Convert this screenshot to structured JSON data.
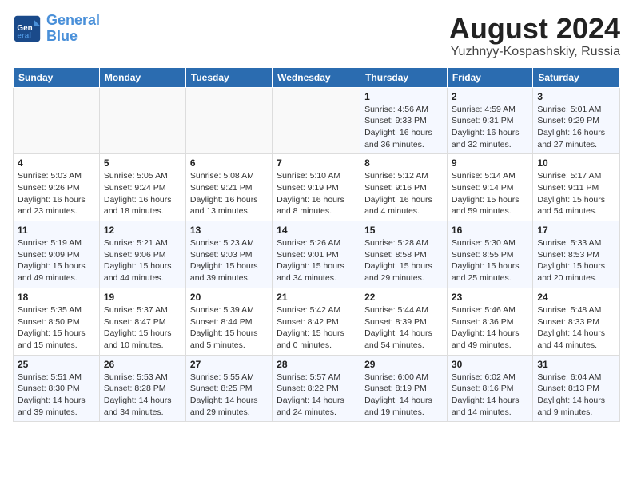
{
  "logo": {
    "line1": "General",
    "line2": "Blue"
  },
  "title": "August 2024",
  "subtitle": "Yuzhnyy-Kospashskiy, Russia",
  "days_of_week": [
    "Sunday",
    "Monday",
    "Tuesday",
    "Wednesday",
    "Thursday",
    "Friday",
    "Saturday"
  ],
  "weeks": [
    [
      {
        "day": "",
        "info": ""
      },
      {
        "day": "",
        "info": ""
      },
      {
        "day": "",
        "info": ""
      },
      {
        "day": "",
        "info": ""
      },
      {
        "day": "1",
        "info": "Sunrise: 4:56 AM\nSunset: 9:33 PM\nDaylight: 16 hours\nand 36 minutes."
      },
      {
        "day": "2",
        "info": "Sunrise: 4:59 AM\nSunset: 9:31 PM\nDaylight: 16 hours\nand 32 minutes."
      },
      {
        "day": "3",
        "info": "Sunrise: 5:01 AM\nSunset: 9:29 PM\nDaylight: 16 hours\nand 27 minutes."
      }
    ],
    [
      {
        "day": "4",
        "info": "Sunrise: 5:03 AM\nSunset: 9:26 PM\nDaylight: 16 hours\nand 23 minutes."
      },
      {
        "day": "5",
        "info": "Sunrise: 5:05 AM\nSunset: 9:24 PM\nDaylight: 16 hours\nand 18 minutes."
      },
      {
        "day": "6",
        "info": "Sunrise: 5:08 AM\nSunset: 9:21 PM\nDaylight: 16 hours\nand 13 minutes."
      },
      {
        "day": "7",
        "info": "Sunrise: 5:10 AM\nSunset: 9:19 PM\nDaylight: 16 hours\nand 8 minutes."
      },
      {
        "day": "8",
        "info": "Sunrise: 5:12 AM\nSunset: 9:16 PM\nDaylight: 16 hours\nand 4 minutes."
      },
      {
        "day": "9",
        "info": "Sunrise: 5:14 AM\nSunset: 9:14 PM\nDaylight: 15 hours\nand 59 minutes."
      },
      {
        "day": "10",
        "info": "Sunrise: 5:17 AM\nSunset: 9:11 PM\nDaylight: 15 hours\nand 54 minutes."
      }
    ],
    [
      {
        "day": "11",
        "info": "Sunrise: 5:19 AM\nSunset: 9:09 PM\nDaylight: 15 hours\nand 49 minutes."
      },
      {
        "day": "12",
        "info": "Sunrise: 5:21 AM\nSunset: 9:06 PM\nDaylight: 15 hours\nand 44 minutes."
      },
      {
        "day": "13",
        "info": "Sunrise: 5:23 AM\nSunset: 9:03 PM\nDaylight: 15 hours\nand 39 minutes."
      },
      {
        "day": "14",
        "info": "Sunrise: 5:26 AM\nSunset: 9:01 PM\nDaylight: 15 hours\nand 34 minutes."
      },
      {
        "day": "15",
        "info": "Sunrise: 5:28 AM\nSunset: 8:58 PM\nDaylight: 15 hours\nand 29 minutes."
      },
      {
        "day": "16",
        "info": "Sunrise: 5:30 AM\nSunset: 8:55 PM\nDaylight: 15 hours\nand 25 minutes."
      },
      {
        "day": "17",
        "info": "Sunrise: 5:33 AM\nSunset: 8:53 PM\nDaylight: 15 hours\nand 20 minutes."
      }
    ],
    [
      {
        "day": "18",
        "info": "Sunrise: 5:35 AM\nSunset: 8:50 PM\nDaylight: 15 hours\nand 15 minutes."
      },
      {
        "day": "19",
        "info": "Sunrise: 5:37 AM\nSunset: 8:47 PM\nDaylight: 15 hours\nand 10 minutes."
      },
      {
        "day": "20",
        "info": "Sunrise: 5:39 AM\nSunset: 8:44 PM\nDaylight: 15 hours\nand 5 minutes."
      },
      {
        "day": "21",
        "info": "Sunrise: 5:42 AM\nSunset: 8:42 PM\nDaylight: 15 hours\nand 0 minutes."
      },
      {
        "day": "22",
        "info": "Sunrise: 5:44 AM\nSunset: 8:39 PM\nDaylight: 14 hours\nand 54 minutes."
      },
      {
        "day": "23",
        "info": "Sunrise: 5:46 AM\nSunset: 8:36 PM\nDaylight: 14 hours\nand 49 minutes."
      },
      {
        "day": "24",
        "info": "Sunrise: 5:48 AM\nSunset: 8:33 PM\nDaylight: 14 hours\nand 44 minutes."
      }
    ],
    [
      {
        "day": "25",
        "info": "Sunrise: 5:51 AM\nSunset: 8:30 PM\nDaylight: 14 hours\nand 39 minutes."
      },
      {
        "day": "26",
        "info": "Sunrise: 5:53 AM\nSunset: 8:28 PM\nDaylight: 14 hours\nand 34 minutes."
      },
      {
        "day": "27",
        "info": "Sunrise: 5:55 AM\nSunset: 8:25 PM\nDaylight: 14 hours\nand 29 minutes."
      },
      {
        "day": "28",
        "info": "Sunrise: 5:57 AM\nSunset: 8:22 PM\nDaylight: 14 hours\nand 24 minutes."
      },
      {
        "day": "29",
        "info": "Sunrise: 6:00 AM\nSunset: 8:19 PM\nDaylight: 14 hours\nand 19 minutes."
      },
      {
        "day": "30",
        "info": "Sunrise: 6:02 AM\nSunset: 8:16 PM\nDaylight: 14 hours\nand 14 minutes."
      },
      {
        "day": "31",
        "info": "Sunrise: 6:04 AM\nSunset: 8:13 PM\nDaylight: 14 hours\nand 9 minutes."
      }
    ]
  ]
}
